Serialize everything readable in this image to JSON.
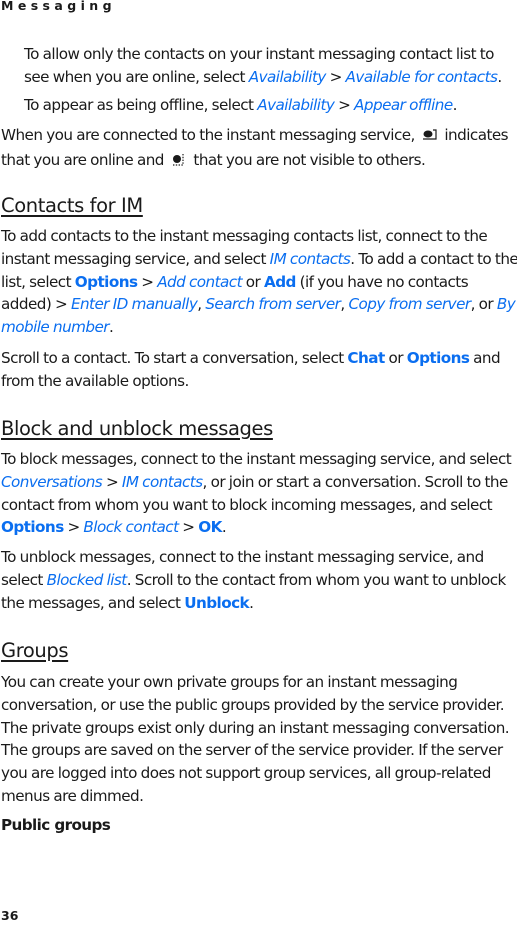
{
  "running_head": "Messaging",
  "page_number": "36",
  "colors": {
    "link_blue": "#0a6ef0",
    "text": "#1a1a1a"
  },
  "icons": {
    "online_status": "im-online-status-icon",
    "invisible_status": "im-invisible-status-icon"
  },
  "intro": {
    "p1": {
      "t1": "To allow only the contacts on your instant messaging contact list to see when you are online, select ",
      "m1": "Availability",
      "t2": " > ",
      "m2": "Available for contacts",
      "t3": "."
    },
    "p2": {
      "t1": "To appear as being offline, select ",
      "m1": "Availability",
      "t2": " > ",
      "m2": "Appear offline",
      "t3": "."
    },
    "p3": {
      "t1": "When you are connected to the instant messaging service, ",
      "t2": " indicates that you are online and ",
      "t3": " that you are not visible to others."
    }
  },
  "sections": {
    "contacts": {
      "heading": "Contacts for IM",
      "p1": {
        "t1": "To add contacts to the instant messaging contacts list, connect to the instant messaging service, and select ",
        "m1": "IM contacts",
        "t2": ". To add a contact to the list, select ",
        "k1": "Options",
        "t3": " > ",
        "m2": "Add contact",
        "t4": " or ",
        "k2": "Add",
        "t5": " (if you have no contacts added) > ",
        "m3": "Enter ID manually",
        "t6": ", ",
        "m4": "Search from server",
        "t7": ", ",
        "m5": "Copy from server",
        "t8": ", or ",
        "m6": "By mobile number",
        "t9": "."
      },
      "p2": {
        "t1": "Scroll to a contact. To start a conversation, select ",
        "k1": "Chat",
        "t2": " or ",
        "k2": "Options",
        "t3": " and from the available options."
      }
    },
    "block": {
      "heading": "Block and unblock messages",
      "p1": {
        "t1": "To block messages, connect to the instant messaging service, and select ",
        "m1": "Conversations",
        "t2": " > ",
        "m2": "IM contacts",
        "t3": ", or join or start a conversation. Scroll to the contact from whom you want to block incoming messages, and select ",
        "k1": "Options",
        "t4": " > ",
        "m3": "Block contact",
        "t5": " > ",
        "k2": "OK",
        "t6": "."
      },
      "p2": {
        "t1": "To unblock messages, connect to the instant messaging service, and select ",
        "m1": "Blocked list",
        "t2": ". Scroll to the contact from whom you want to unblock the messages, and select ",
        "k1": "Unblock",
        "t3": "."
      }
    },
    "groups": {
      "heading": "Groups",
      "p1": "You can create your own private groups for an instant messaging conversation, or use the public groups provided by the service provider. The private groups exist only during an instant messaging conversation. The groups are saved on the server of the service provider. If the server you are logged into does not support group services, all group-related menus are dimmed.",
      "subheading": "Public groups"
    }
  }
}
